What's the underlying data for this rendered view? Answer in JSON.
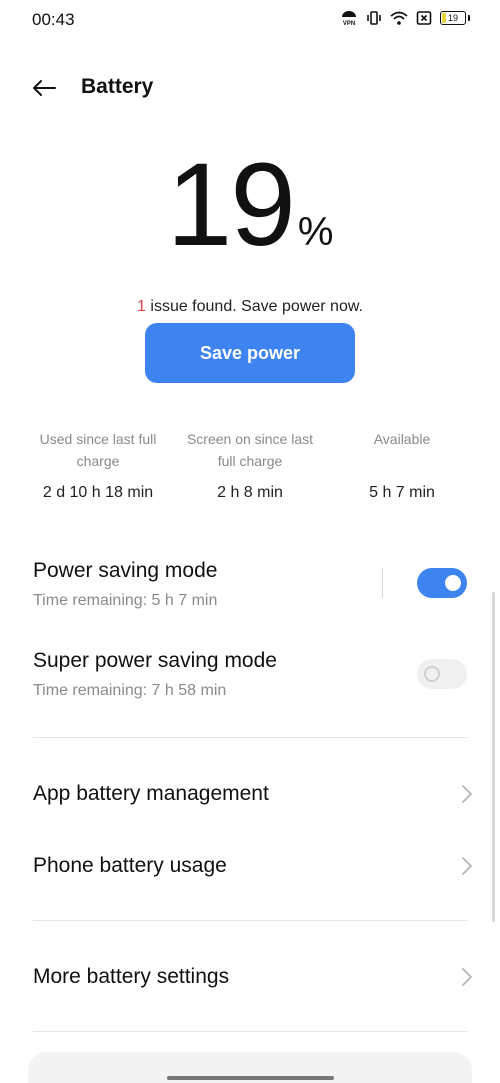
{
  "status_bar": {
    "time": "00:43",
    "battery_level_text": "19",
    "battery_fraction": 0.19,
    "icons": [
      "vpn-icon",
      "vibrate-icon",
      "wifi-icon",
      "sim-x-icon",
      "battery-icon"
    ]
  },
  "header": {
    "title": "Battery",
    "back_icon": "arrow-left-icon"
  },
  "battery": {
    "percent": "19",
    "percent_sign": "%",
    "issue_count": "1",
    "issue_text": " issue found. Save power now.",
    "save_button_label": "Save power"
  },
  "stats": [
    {
      "label": "Used since last full charge",
      "value": "2 d 10 h 18 min"
    },
    {
      "label": "Screen on since last full charge",
      "value": "2 h 8 min"
    },
    {
      "label": "Available",
      "value": "5 h 7 min"
    }
  ],
  "modes": {
    "power_saving": {
      "title": "Power saving mode",
      "subtitle": "Time remaining:  5 h 7 min",
      "enabled": true
    },
    "super_power_saving": {
      "title": "Super power saving mode",
      "subtitle": "Time remaining:  7 h 58 min",
      "enabled": false
    }
  },
  "menu": {
    "app_battery_management": "App battery management",
    "phone_battery_usage": "Phone battery usage",
    "more_battery_settings": "More battery settings",
    "chevron_icon": "chevron-right-icon"
  },
  "colors": {
    "accent": "#3d84f0",
    "issue_red": "#e0404a",
    "secondary_text": "#8a8a8a"
  }
}
